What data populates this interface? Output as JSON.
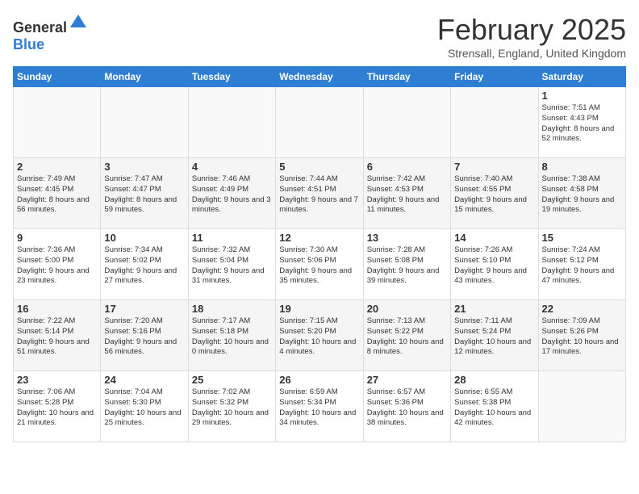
{
  "header": {
    "logo_general": "General",
    "logo_blue": "Blue",
    "month_title": "February 2025",
    "location": "Strensall, England, United Kingdom"
  },
  "columns": [
    "Sunday",
    "Monday",
    "Tuesday",
    "Wednesday",
    "Thursday",
    "Friday",
    "Saturday"
  ],
  "weeks": [
    [
      {
        "day": "",
        "info": ""
      },
      {
        "day": "",
        "info": ""
      },
      {
        "day": "",
        "info": ""
      },
      {
        "day": "",
        "info": ""
      },
      {
        "day": "",
        "info": ""
      },
      {
        "day": "",
        "info": ""
      },
      {
        "day": "1",
        "info": "Sunrise: 7:51 AM\nSunset: 4:43 PM\nDaylight: 8 hours and 52 minutes."
      }
    ],
    [
      {
        "day": "2",
        "info": "Sunrise: 7:49 AM\nSunset: 4:45 PM\nDaylight: 8 hours and 56 minutes."
      },
      {
        "day": "3",
        "info": "Sunrise: 7:47 AM\nSunset: 4:47 PM\nDaylight: 8 hours and 59 minutes."
      },
      {
        "day": "4",
        "info": "Sunrise: 7:46 AM\nSunset: 4:49 PM\nDaylight: 9 hours and 3 minutes."
      },
      {
        "day": "5",
        "info": "Sunrise: 7:44 AM\nSunset: 4:51 PM\nDaylight: 9 hours and 7 minutes."
      },
      {
        "day": "6",
        "info": "Sunrise: 7:42 AM\nSunset: 4:53 PM\nDaylight: 9 hours and 11 minutes."
      },
      {
        "day": "7",
        "info": "Sunrise: 7:40 AM\nSunset: 4:55 PM\nDaylight: 9 hours and 15 minutes."
      },
      {
        "day": "8",
        "info": "Sunrise: 7:38 AM\nSunset: 4:58 PM\nDaylight: 9 hours and 19 minutes."
      }
    ],
    [
      {
        "day": "9",
        "info": "Sunrise: 7:36 AM\nSunset: 5:00 PM\nDaylight: 9 hours and 23 minutes."
      },
      {
        "day": "10",
        "info": "Sunrise: 7:34 AM\nSunset: 5:02 PM\nDaylight: 9 hours and 27 minutes."
      },
      {
        "day": "11",
        "info": "Sunrise: 7:32 AM\nSunset: 5:04 PM\nDaylight: 9 hours and 31 minutes."
      },
      {
        "day": "12",
        "info": "Sunrise: 7:30 AM\nSunset: 5:06 PM\nDaylight: 9 hours and 35 minutes."
      },
      {
        "day": "13",
        "info": "Sunrise: 7:28 AM\nSunset: 5:08 PM\nDaylight: 9 hours and 39 minutes."
      },
      {
        "day": "14",
        "info": "Sunrise: 7:26 AM\nSunset: 5:10 PM\nDaylight: 9 hours and 43 minutes."
      },
      {
        "day": "15",
        "info": "Sunrise: 7:24 AM\nSunset: 5:12 PM\nDaylight: 9 hours and 47 minutes."
      }
    ],
    [
      {
        "day": "16",
        "info": "Sunrise: 7:22 AM\nSunset: 5:14 PM\nDaylight: 9 hours and 51 minutes."
      },
      {
        "day": "17",
        "info": "Sunrise: 7:20 AM\nSunset: 5:16 PM\nDaylight: 9 hours and 56 minutes."
      },
      {
        "day": "18",
        "info": "Sunrise: 7:17 AM\nSunset: 5:18 PM\nDaylight: 10 hours and 0 minutes."
      },
      {
        "day": "19",
        "info": "Sunrise: 7:15 AM\nSunset: 5:20 PM\nDaylight: 10 hours and 4 minutes."
      },
      {
        "day": "20",
        "info": "Sunrise: 7:13 AM\nSunset: 5:22 PM\nDaylight: 10 hours and 8 minutes."
      },
      {
        "day": "21",
        "info": "Sunrise: 7:11 AM\nSunset: 5:24 PM\nDaylight: 10 hours and 12 minutes."
      },
      {
        "day": "22",
        "info": "Sunrise: 7:09 AM\nSunset: 5:26 PM\nDaylight: 10 hours and 17 minutes."
      }
    ],
    [
      {
        "day": "23",
        "info": "Sunrise: 7:06 AM\nSunset: 5:28 PM\nDaylight: 10 hours and 21 minutes."
      },
      {
        "day": "24",
        "info": "Sunrise: 7:04 AM\nSunset: 5:30 PM\nDaylight: 10 hours and 25 minutes."
      },
      {
        "day": "25",
        "info": "Sunrise: 7:02 AM\nSunset: 5:32 PM\nDaylight: 10 hours and 29 minutes."
      },
      {
        "day": "26",
        "info": "Sunrise: 6:59 AM\nSunset: 5:34 PM\nDaylight: 10 hours and 34 minutes."
      },
      {
        "day": "27",
        "info": "Sunrise: 6:57 AM\nSunset: 5:36 PM\nDaylight: 10 hours and 38 minutes."
      },
      {
        "day": "28",
        "info": "Sunrise: 6:55 AM\nSunset: 5:38 PM\nDaylight: 10 hours and 42 minutes."
      },
      {
        "day": "",
        "info": ""
      }
    ]
  ]
}
